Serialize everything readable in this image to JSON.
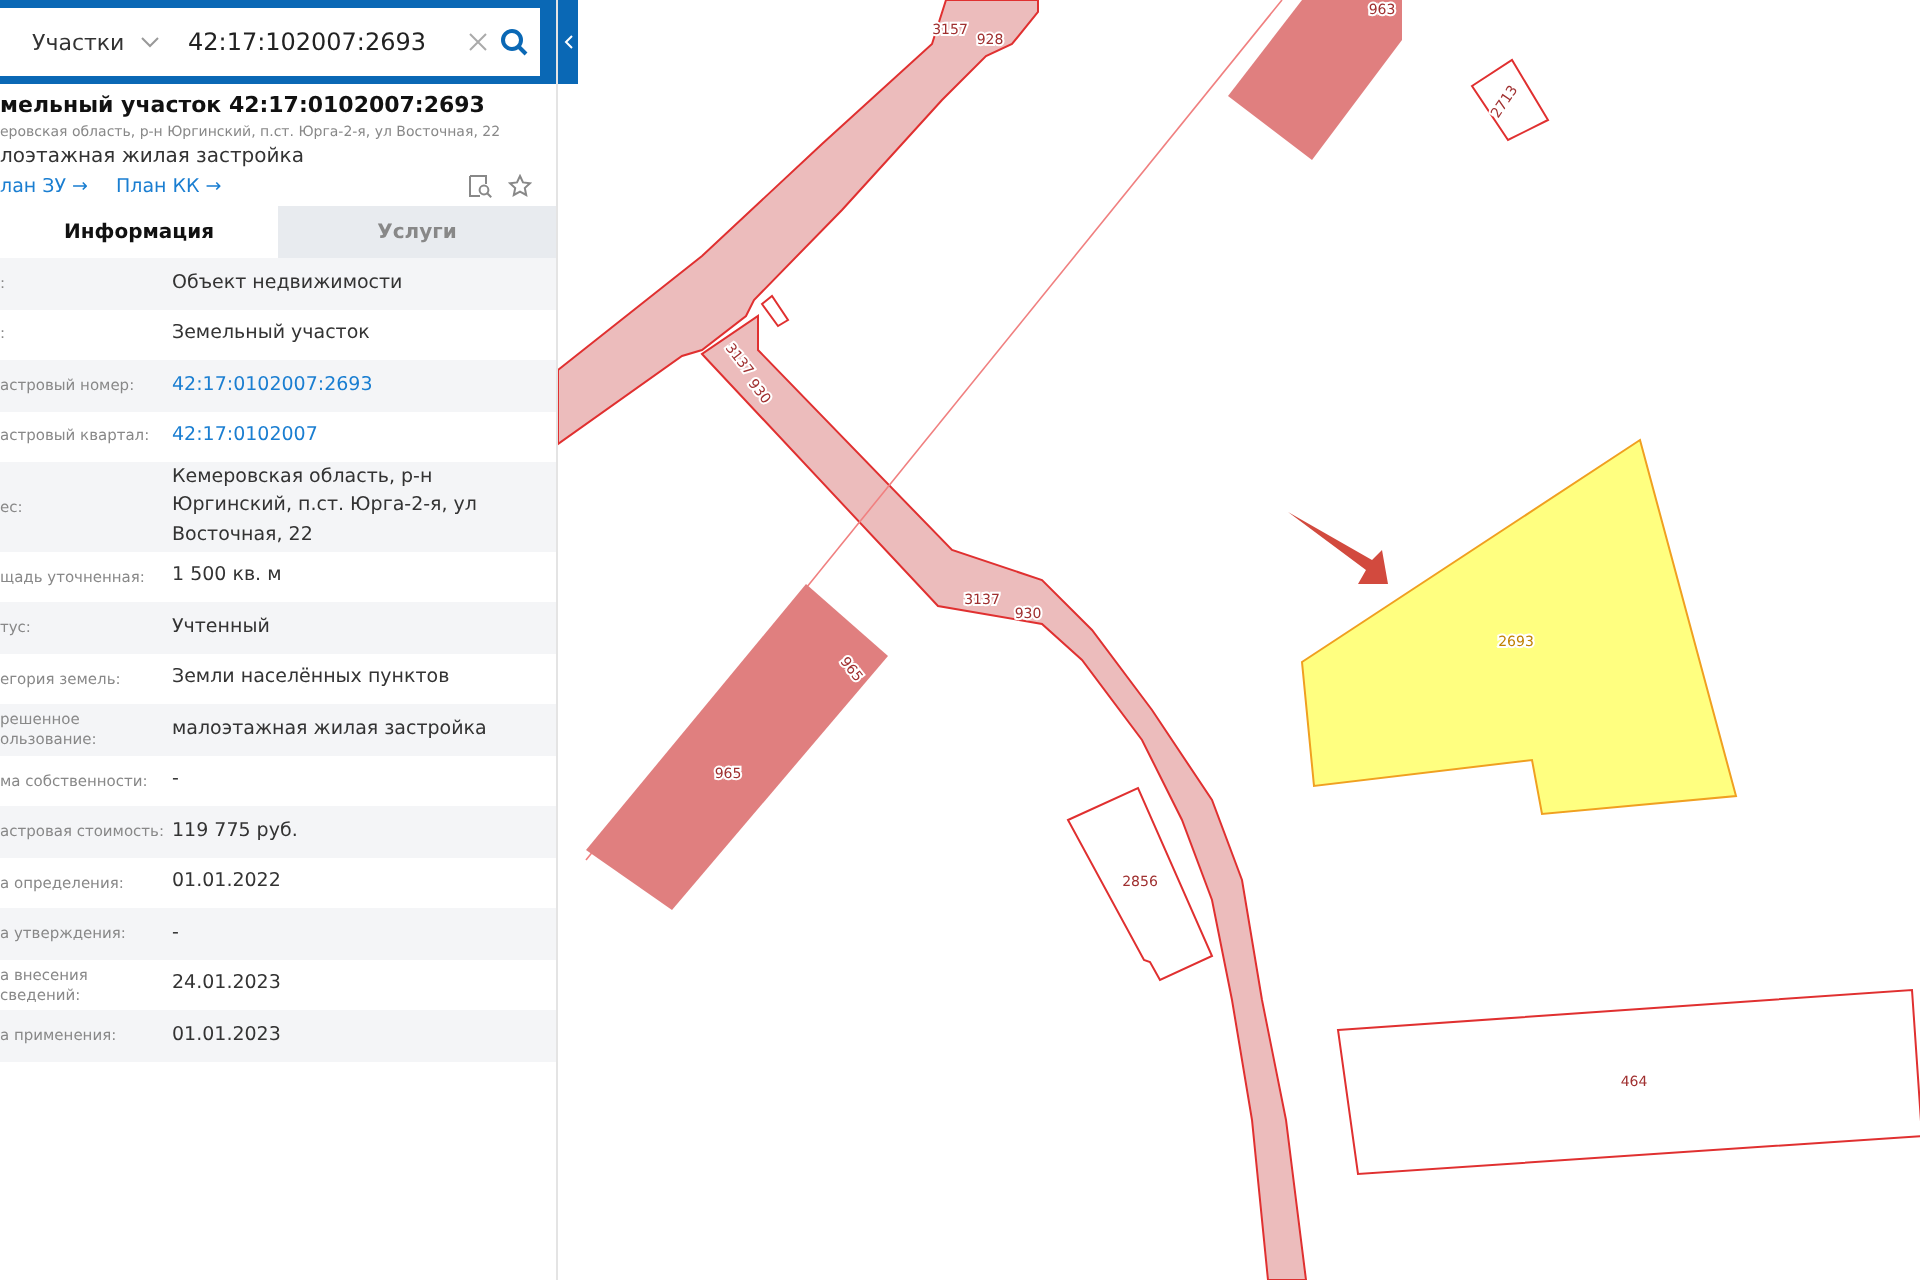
{
  "search": {
    "layer": "Участки",
    "value": "42:17:102007:2693"
  },
  "object": {
    "title": "мельный участок 42:17:0102007:2693",
    "address": "еровская область, р-н Юргинский, п.ст. Юрга-2-я, ул Восточная, 22",
    "usage": "лоэтажная жилая застройка",
    "links": [
      "лан ЗУ →",
      "План КК →"
    ]
  },
  "tabs": [
    {
      "label": "Информация",
      "selected": true
    },
    {
      "label": "Услуги",
      "selected": false
    }
  ],
  "rows": [
    {
      "label": ":",
      "value": "Объект недвижимости",
      "kind": "text"
    },
    {
      "label": ":",
      "value": "Земельный участок",
      "kind": "text"
    },
    {
      "label": "астровый номер:",
      "value": "42:17:0102007:2693",
      "kind": "link"
    },
    {
      "label": "астровый квартал:",
      "value": "42:17:0102007",
      "kind": "link"
    },
    {
      "label": "ес:",
      "value": "Кемеровская область, р-н Юргинский, п.ст. Юрга-2-я, ул Восточная, 22",
      "kind": "text"
    },
    {
      "label": "щадь уточненная:",
      "value": "1 500 кв. м",
      "kind": "text"
    },
    {
      "label": "тус:",
      "value": "Учтенный",
      "kind": "text"
    },
    {
      "label": "егория земель:",
      "value": "Земли населённых пунктов",
      "kind": "text"
    },
    {
      "label": "решенное\nользование:",
      "value": "малоэтажная жилая застройка",
      "kind": "text"
    },
    {
      "label": "ма собственности:",
      "value": "-",
      "kind": "text"
    },
    {
      "label": "астровая стоимость:",
      "value": "119 775 руб.",
      "kind": "text"
    },
    {
      "label": "а определения:",
      "value": "01.01.2022",
      "kind": "text"
    },
    {
      "label": "а утверждения:",
      "value": "-",
      "kind": "text"
    },
    {
      "label": "а внесения сведений:",
      "value": "24.01.2023",
      "kind": "text"
    },
    {
      "label": "а применения:",
      "value": "01.01.2023",
      "kind": "text"
    }
  ],
  "map": {
    "labels": [
      "3157",
      "928",
      "963",
      "2713",
      "3137",
      "930",
      "965",
      "965",
      "3137",
      "930",
      "2693",
      "2856",
      "464"
    ]
  }
}
